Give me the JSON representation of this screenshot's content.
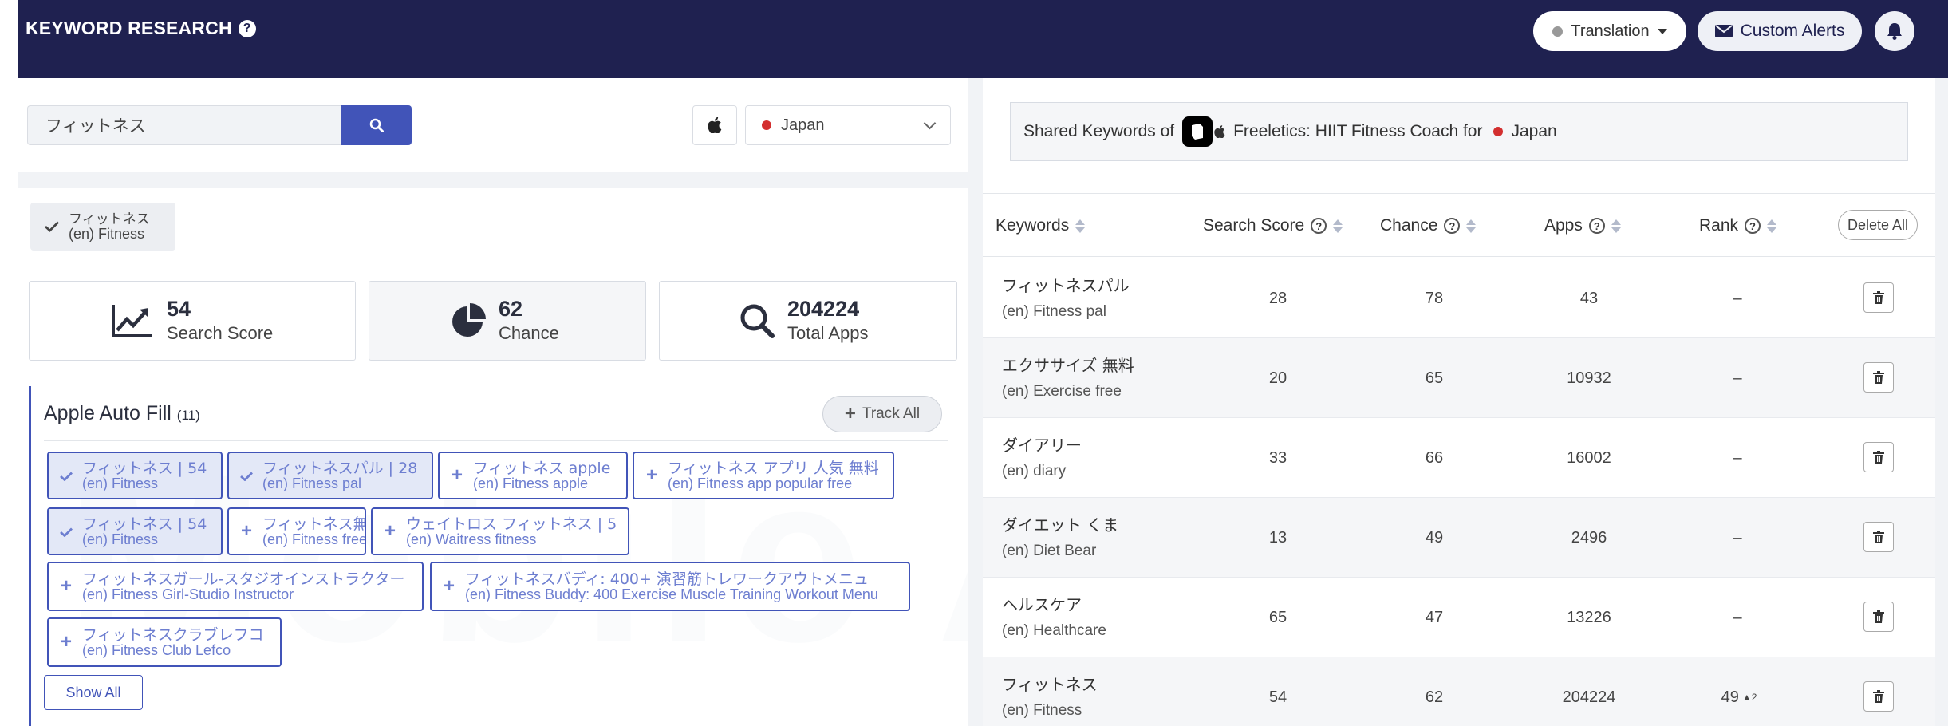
{
  "header": {
    "title": "KEYWORD RESEARCH",
    "translation_label": "Translation",
    "custom_alerts_label": "Custom Alerts"
  },
  "search": {
    "query": "フィットネス",
    "country": "Japan"
  },
  "selected_keyword": {
    "jp": "フィットネス",
    "en": "(en) Fitness"
  },
  "stats": {
    "search_score": {
      "value": "54",
      "label": "Search Score"
    },
    "chance": {
      "value": "62",
      "label": "Chance"
    },
    "total_apps": {
      "value": "204224",
      "label": "Total Apps"
    }
  },
  "autofill": {
    "title": "Apple Auto Fill",
    "count": "(11)",
    "track_all_label": "Track All",
    "show_all_label": "Show All",
    "chips": [
      {
        "jp": "フィットネス | 54",
        "en": "(en) Fitness",
        "selected": true
      },
      {
        "jp": "フィットネスパル | 28",
        "en": "(en) Fitness pal",
        "selected": true
      },
      {
        "jp": "フィットネス apple",
        "en": "(en) Fitness apple",
        "selected": false
      },
      {
        "jp": "フィットネス アプリ 人気 無料",
        "en": "(en) Fitness app popular free",
        "selected": false
      },
      {
        "jp": "フィットネス | 54",
        "en": "(en) Fitness",
        "selected": true
      },
      {
        "jp": "フィットネス無料",
        "en": "(en) Fitness free",
        "selected": false
      },
      {
        "jp": "ウェイトロス フィットネス | 5",
        "en": "(en) Waitress fitness",
        "selected": false
      },
      {
        "jp": "フィットネスガール-スタジオインストラクター",
        "en": "(en) Fitness Girl-Studio Instructor",
        "selected": false
      },
      {
        "jp": "フィットネスバディ: 400+ 演習筋トレワークアウトメニュ",
        "en": "(en) Fitness Buddy: 400 Exercise Muscle Training Workout Menu",
        "selected": false
      },
      {
        "jp": "フィットネスクラブレフコ",
        "en": "(en) Fitness Club Lefco",
        "selected": false
      }
    ]
  },
  "shared": {
    "prefix": "Shared Keywords of",
    "app_name": "Freeletics: HIIT Fitness Coach for",
    "country": "Japan"
  },
  "table": {
    "columns": [
      "Keywords",
      "Search Score",
      "Chance",
      "Apps",
      "Rank"
    ],
    "delete_all_label": "Delete All",
    "rows": [
      {
        "jp": "フィットネスパル",
        "en": "(en) Fitness pal",
        "search_score": "28",
        "chance": "78",
        "apps": "43",
        "rank": "–",
        "rank_change": ""
      },
      {
        "jp": "エクササイズ 無料",
        "en": "(en) Exercise free",
        "search_score": "20",
        "chance": "65",
        "apps": "10932",
        "rank": "–",
        "rank_change": ""
      },
      {
        "jp": "ダイアリー",
        "en": "(en) diary",
        "search_score": "33",
        "chance": "66",
        "apps": "16002",
        "rank": "–",
        "rank_change": ""
      },
      {
        "jp": "ダイエット くま",
        "en": "(en) Diet Bear",
        "search_score": "13",
        "chance": "49",
        "apps": "2496",
        "rank": "–",
        "rank_change": ""
      },
      {
        "jp": "ヘルスケア",
        "en": "(en) Healthcare",
        "search_score": "65",
        "chance": "47",
        "apps": "13226",
        "rank": "–",
        "rank_change": ""
      },
      {
        "jp": "フィットネス",
        "en": "(en) Fitness",
        "search_score": "54",
        "chance": "62",
        "apps": "204224",
        "rank": "49",
        "rank_change": "▲2"
      }
    ]
  }
}
